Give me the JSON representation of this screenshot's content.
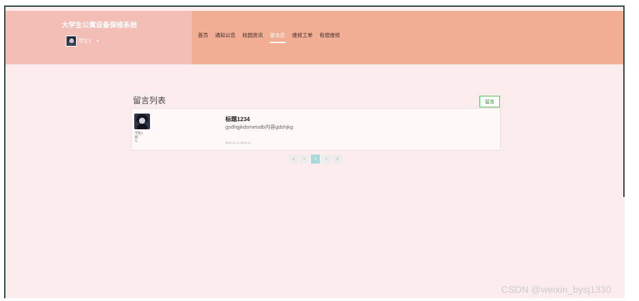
{
  "header": {
    "site_title": "大学生公寓设备保修系统",
    "user_name": "学生1",
    "user_caret": "▾"
  },
  "nav": [
    {
      "label": "首页"
    },
    {
      "label": "通知公告"
    },
    {
      "label": "校园资讯"
    },
    {
      "label": "留言区",
      "active": true
    },
    {
      "label": "维修工单"
    },
    {
      "label": "有偿维修"
    }
  ],
  "main": {
    "section_title": "留言列表",
    "post_button": "留言"
  },
  "messages": [
    {
      "user": "学生1",
      "meta1": "回",
      "meta2": "✎",
      "title": "标题1234",
      "content": "gsdhgjkdsmeisdb内容gdshjkg",
      "time": "2022-12-17 09:41:10"
    }
  ],
  "pagination": {
    "first": "«",
    "prev": "‹",
    "current": "1",
    "next": "›",
    "last": "»"
  },
  "watermark": "CSDN @weixin_bysj1330",
  "colors": {
    "brand_panel": "#f3beb6",
    "nav_panel": "#f2ad95",
    "page_background": "#fdeced",
    "accent_green": "#5cb85c",
    "pagination_active": "#a9d8d8"
  }
}
